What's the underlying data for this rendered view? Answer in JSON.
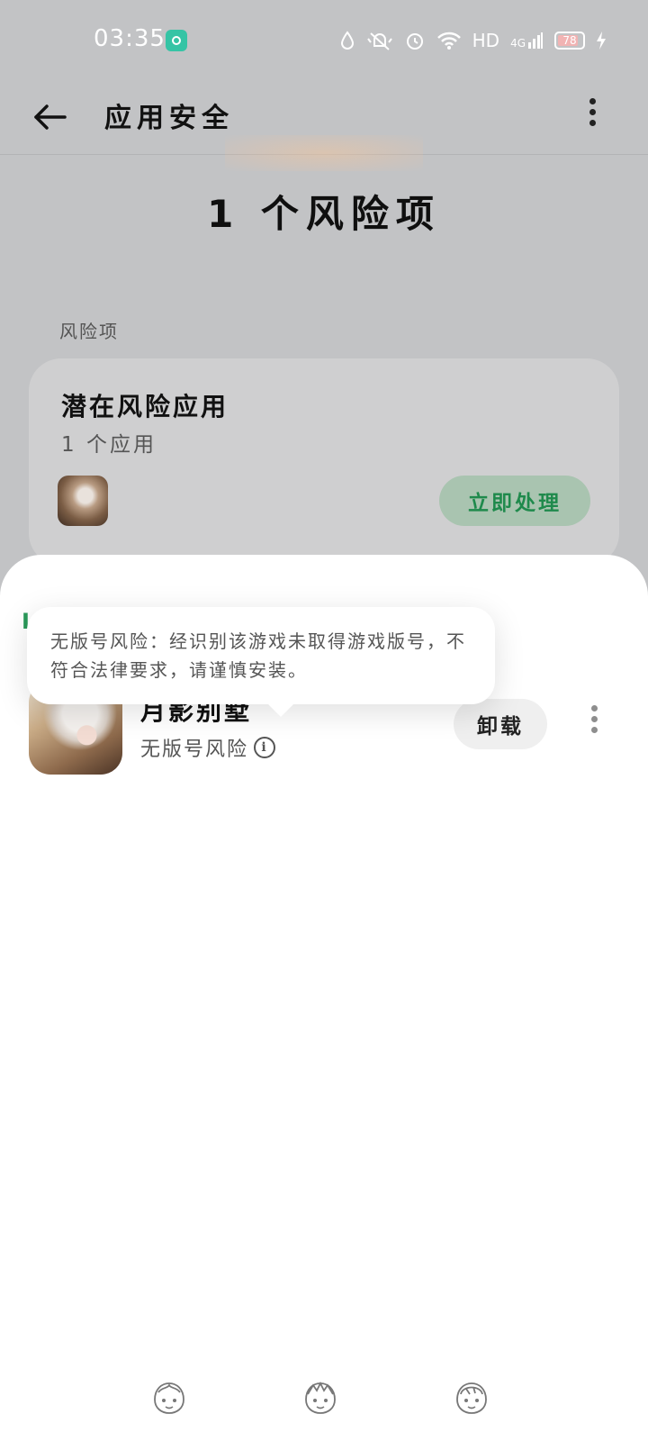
{
  "status_bar": {
    "time": "03:35",
    "network": "HD",
    "cell": "4G",
    "battery": "78"
  },
  "header": {
    "title": "应用安全"
  },
  "hero": {
    "risk_count": "1 个风险项"
  },
  "section": {
    "label": "风险项"
  },
  "risk_card": {
    "title": "潜在风险应用",
    "subtitle": "1 个应用",
    "action_label": "立即处理"
  },
  "sheet": {
    "partial_label": "I",
    "app": {
      "name": "月影别墅",
      "risk_label": "无版号风险",
      "uninstall_label": "卸载"
    },
    "tooltip": "无版号风险：经识别该游戏未取得游戏版号，不符合法律要求，请谨慎安装。"
  },
  "colors": {
    "accent_green": "#1f8a4c",
    "action_bg": "#a9c4b0",
    "scrim": "#c2c3c5"
  },
  "icons": [
    "back-arrow-icon",
    "more-vertical-icon",
    "info-icon",
    "mascot-icon"
  ]
}
